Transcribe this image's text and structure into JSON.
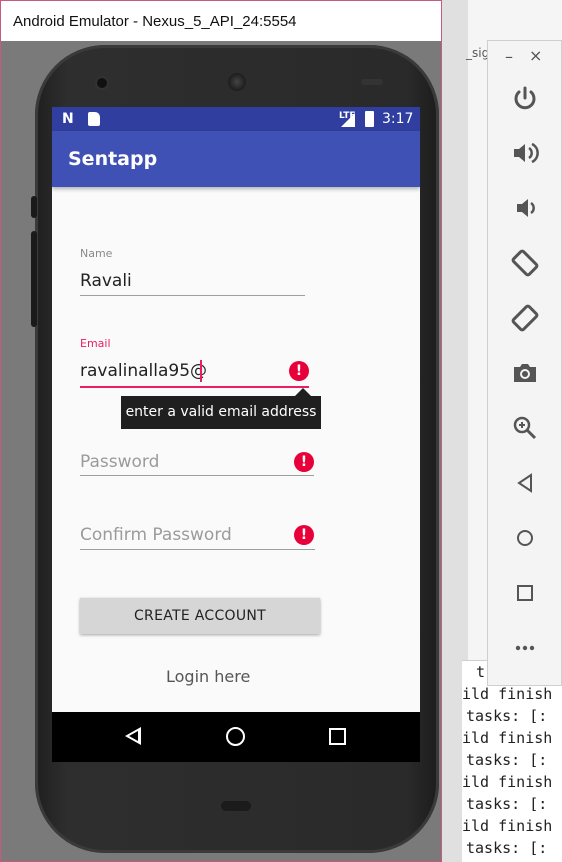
{
  "emulator_window": {
    "title": "Android Emulator - Nexus_5_API_24:5554"
  },
  "ide_background": {
    "tab_fragment": "_sig",
    "console_lines": [
      "t",
      "ild finish",
      " tasks: [:",
      "ild finish",
      " tasks: [:",
      "ild finish",
      " tasks: [:",
      "ild finish",
      " tasks: [:"
    ]
  },
  "status_bar": {
    "network_label": "LTE",
    "time": "3:17"
  },
  "app_bar": {
    "title": "Sentapp"
  },
  "form": {
    "name": {
      "label": "Name",
      "value": "Ravali"
    },
    "email": {
      "label": "Email",
      "value": "ravalinalla95@",
      "error": "enter a valid email address"
    },
    "password": {
      "placeholder": "Password"
    },
    "confirm_password": {
      "placeholder": "Confirm Password"
    },
    "create_account_label": "CREATE ACCOUNT",
    "login_link_label": "Login here"
  },
  "colors": {
    "primary": "#3f51b5",
    "primary_dark": "#303f9f",
    "accent": "#e91e63",
    "error": "#e8003a"
  },
  "side_toolbar": {
    "minimize_glyph": "–",
    "close_glyph": "×",
    "tools": [
      "power-icon",
      "volume-up-icon",
      "volume-down-icon",
      "rotate-left-icon",
      "rotate-right-icon",
      "camera-icon",
      "zoom-icon",
      "back-icon",
      "home-icon",
      "overview-icon",
      "more-icon"
    ]
  }
}
